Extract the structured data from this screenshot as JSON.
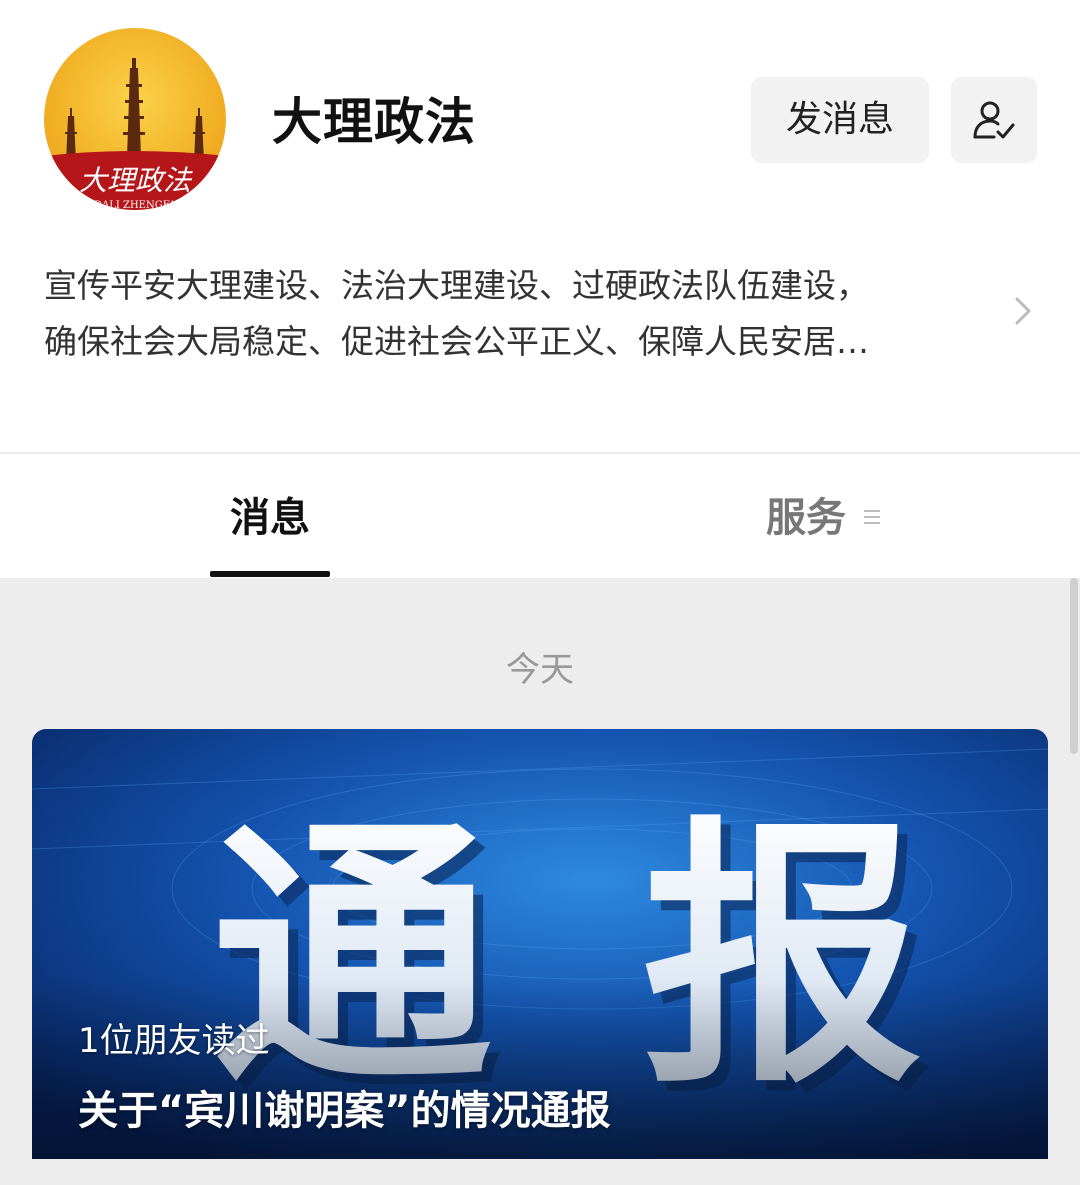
{
  "account": {
    "name": "大理政法",
    "logo_text": "大理政法",
    "logo_subtext": "DALI ZHENGFA"
  },
  "actions": {
    "send_message_label": "发消息",
    "follow_icon": "user-check-icon"
  },
  "description": {
    "line1": "宣传平安大理建设、法治大理建设、过硬政法队伍建设，",
    "line2": "确保社会大局稳定、促进社会公平正义、保障人民安居…",
    "arrow_icon": "chevron-right-icon"
  },
  "tabs": [
    {
      "label": "消息",
      "active": true
    },
    {
      "label": "服务",
      "active": false,
      "icon": "menu-lines-icon"
    }
  ],
  "feed": {
    "date_label": "今天",
    "articles": [
      {
        "cover_text_1": "通",
        "cover_text_2": "报",
        "read_count_text": "1位朋友读过",
        "title": "关于“宾川谢明案”的情况通报"
      }
    ]
  },
  "colors": {
    "logo_yellow": "#f2b321",
    "logo_red": "#b5161a",
    "cover_blue_dark": "#0a2b6e",
    "cover_blue_light": "#2a7fd6",
    "content_bg": "#ededed",
    "button_bg": "#f2f2f2"
  }
}
